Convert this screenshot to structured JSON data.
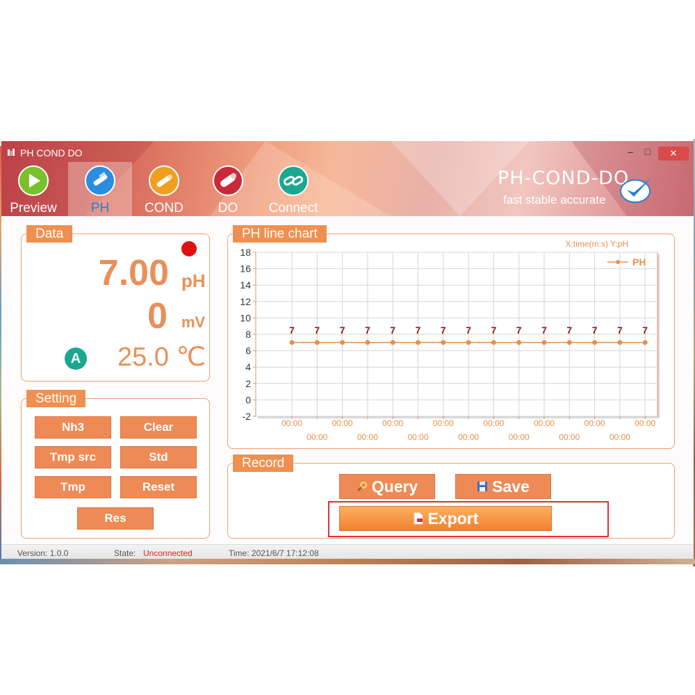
{
  "window": {
    "title": "PH COND DO",
    "minimize_label": "–",
    "maximize_label": "□",
    "close_label": "✕"
  },
  "nav": {
    "tabs": [
      {
        "label": "Preview",
        "icon": "play-icon",
        "color": "#7ac02a"
      },
      {
        "label": "PH",
        "icon": "ph-probe-icon",
        "color": "#2a8ee0",
        "active": true
      },
      {
        "label": "COND",
        "icon": "cond-probe-icon",
        "color": "#f0a020"
      },
      {
        "label": "DO",
        "icon": "do-probe-icon",
        "color": "#c82a3a"
      },
      {
        "label": "Connect",
        "icon": "link-icon",
        "color": "#1aa890"
      }
    ]
  },
  "brand": {
    "name": "PH-COND-DO",
    "tagline": "fast stable accurate",
    "check_color": "#2a7fd0"
  },
  "data_panel": {
    "title": "Data",
    "ph_value": "7.00",
    "ph_unit": "pH",
    "mv_value": "0",
    "mv_unit": "mV",
    "temp_mode": "A",
    "temp_value": "25.0 ℃",
    "status_color": "#e01010"
  },
  "setting_panel": {
    "title": "Setting",
    "buttons": [
      "Nh3",
      "Clear",
      "Tmp src",
      "Std",
      "Tmp",
      "Reset",
      "Res"
    ]
  },
  "chart_panel": {
    "title": "PH line chart",
    "axis_caption": "X:time(m:s)  Y:pH"
  },
  "chart_data": {
    "type": "line",
    "y_ticks": [
      18,
      16,
      14,
      12,
      10,
      8,
      6,
      4,
      2,
      0,
      -2
    ],
    "ylim": [
      -2,
      18
    ],
    "x": [
      "00:00",
      "00:00",
      "00:00",
      "00:00",
      "00:00",
      "00:00",
      "00:00",
      "00:00",
      "00:00",
      "00:00",
      "00:00",
      "00:00",
      "00:00",
      "00:00",
      "00:00"
    ],
    "series": [
      {
        "name": "PH",
        "values": [
          7,
          7,
          7,
          7,
          7,
          7,
          7,
          7,
          7,
          7,
          7,
          7,
          7,
          7,
          7
        ],
        "color": "#e8904a"
      }
    ],
    "point_labels": [
      "7",
      "7",
      "7",
      "7",
      "7",
      "7",
      "7",
      "7",
      "7",
      "7",
      "7",
      "7",
      "7",
      "7",
      "7"
    ],
    "grid": true,
    "legend": "top-right"
  },
  "record_panel": {
    "title": "Record",
    "query_label": "Query",
    "save_label": "Save",
    "export_label": "Export"
  },
  "status_bar": {
    "version": "Version: 1.0.0",
    "state_label": "State:",
    "state_value": "Unconnected",
    "state_color": "#e02020",
    "time": "Time: 2021/6/7 17:12:08"
  }
}
